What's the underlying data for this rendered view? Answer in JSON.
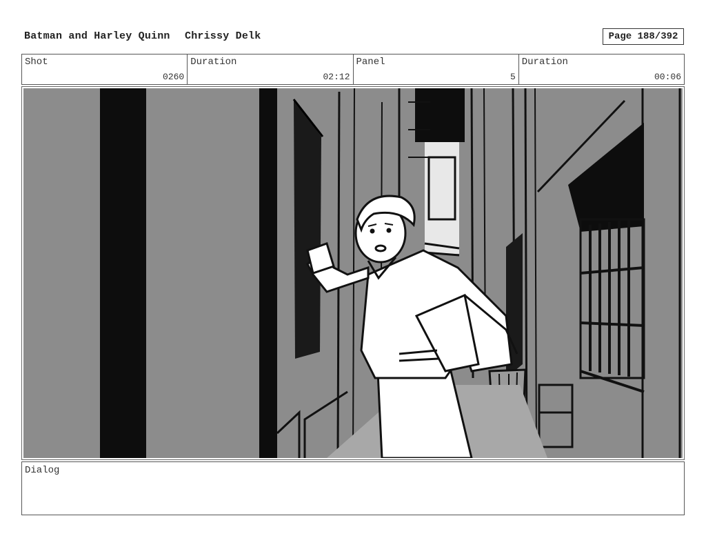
{
  "header": {
    "project_title": "Batman and Harley Quinn",
    "artist": "Chrissy Delk",
    "page": "Page 188/392"
  },
  "info": {
    "shot_label": "Shot",
    "shot_value": "0260",
    "duration_label": "Duration",
    "duration_value": "02:12",
    "panel_label": "Panel",
    "panel_value": "5",
    "panel_duration_label": "Duration",
    "panel_duration_value": "00:06"
  },
  "dialog": {
    "label": "Dialog",
    "text": ""
  },
  "colors": {
    "wall_gray": "#8a8a8a",
    "shadow": "#111111",
    "figure": "#ffffff"
  }
}
